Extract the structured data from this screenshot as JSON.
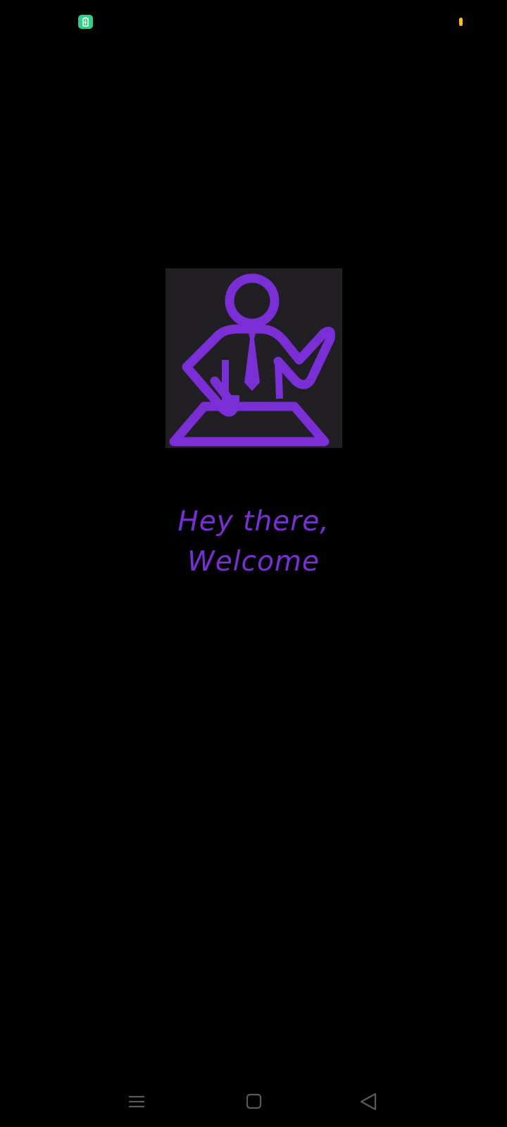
{
  "colors": {
    "accent": "#7a2ed6",
    "background": "#000000",
    "image_background": "#211e24",
    "status_icon": "#2ecf8a",
    "status_dot": "#f2c21b",
    "nav_icon": "#5a5a5a"
  },
  "status_bar": {
    "left_icon": "battery-saver-icon",
    "right_indicator": "privacy-indicator-dot"
  },
  "hero": {
    "icon": "person-at-desk-waving-icon"
  },
  "welcome": {
    "line1": "Hey there,",
    "line2": "Welcome"
  },
  "nav_bar": {
    "menu_icon": "recent-apps-icon",
    "home_icon": "home-icon",
    "back_icon": "back-icon"
  }
}
